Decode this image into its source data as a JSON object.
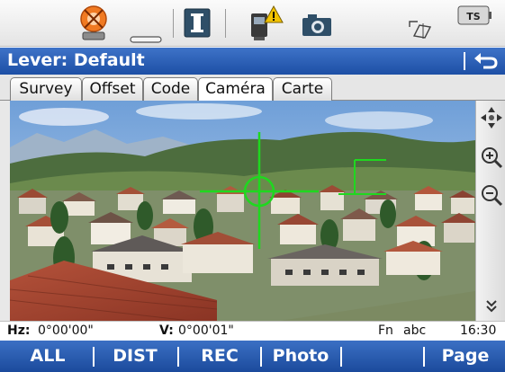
{
  "title": "Lever: Default",
  "tabs": [
    {
      "label": "Survey",
      "active": false
    },
    {
      "label": "Offset",
      "active": false
    },
    {
      "label": "Code",
      "active": false
    },
    {
      "label": "Caméra",
      "active": true
    },
    {
      "label": "Carte",
      "active": false
    }
  ],
  "topbar": {
    "icons": [
      "target-prism-icon",
      "battery-slot-icon",
      "info-icon",
      "instrument-warning-icon",
      "camera-icon",
      "pole-level-icon",
      "ts-instrument-icon"
    ],
    "ts_label": "TS"
  },
  "status": {
    "hz_label": "Hz:",
    "hz_value": "0°00'00\"",
    "v_label": "V:",
    "v_value": "0°00'01\"",
    "fn": "Fn",
    "input_mode": "abc",
    "time": "16:30"
  },
  "softkeys": [
    "ALL",
    "DIST",
    "REC",
    "Photo",
    "",
    "Page"
  ],
  "sidebar": [
    "pan-icon",
    "zoom-in-icon",
    "zoom-out-icon",
    "more-down-icon"
  ],
  "colors": {
    "title_bar": "#2a5db5",
    "softkey_bar": "#2a5db5",
    "crosshair": "#1fd81f"
  }
}
